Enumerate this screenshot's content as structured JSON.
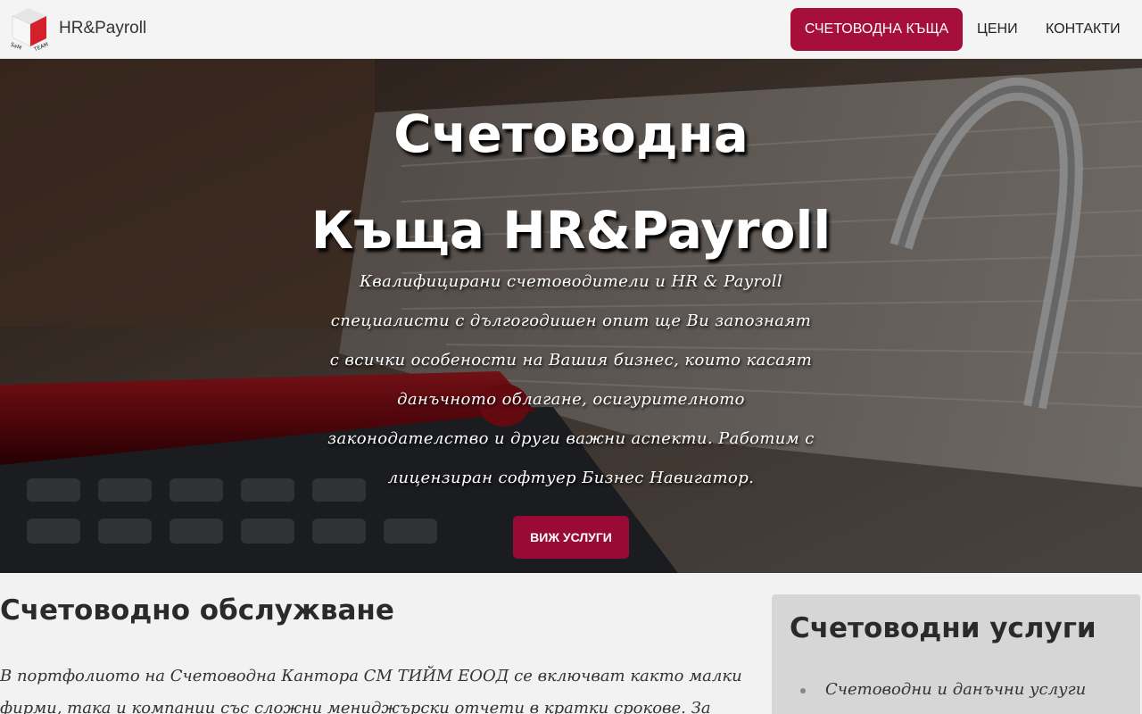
{
  "brand": {
    "name": "HR&Payroll",
    "logo_icon": "cube-logo-icon",
    "logo_text_left": "SaM",
    "logo_text_right": "TEAM"
  },
  "nav": {
    "items": [
      {
        "label": "СЧЕТОВОДНА КЪЩА",
        "active": true
      },
      {
        "label": "ЦЕНИ",
        "active": false
      },
      {
        "label": "КОНТАКТИ",
        "active": false
      }
    ]
  },
  "hero": {
    "title_line1": "Счетоводна",
    "title_line2": "Къща HR&Payroll",
    "text_lines": [
      "Квалифицирани счетоводители и HR & Payroll",
      "специалисти с дългогодишен опит ще Ви запознаят",
      "с всички особености на Вашия бизнес, които касаят",
      "данъчното облагане, осигурителното",
      "законодателство и други важни аспекти. Работим с",
      "лицензиран софтуер Бизнес Навигатор."
    ],
    "cta_label": "ВИЖ УСЛУГИ"
  },
  "main": {
    "title": "Счетоводно обслужване",
    "text_line1": "В портфолиото на Счетоводна Кантора СМ ТИЙМ ЕООД се включват както малки",
    "text_line2": "фирми, така и компании със сложни мениджърски отчети в кратки срокове. За"
  },
  "aside": {
    "title": "Счетоводни услуги",
    "items": [
      "Счетоводни и данъчни услуги"
    ]
  },
  "colors": {
    "accent": "#a50f3a",
    "button": "#990a35",
    "aside_bg": "#d6d6d6"
  }
}
